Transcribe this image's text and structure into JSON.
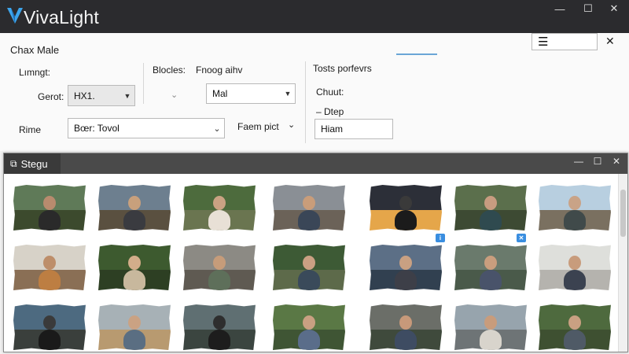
{
  "app": {
    "title": "VivaLight"
  },
  "window_controls": {
    "minimize": "—",
    "maximize": "☐",
    "close": "✕"
  },
  "panel": {
    "heading": "Chax Male",
    "menu_glyph": "☰",
    "close_glyph": "✕",
    "group1_label": "Lımngt:",
    "gerot_label": "Gerot:",
    "gerot_value": "HX1.",
    "rime_label": "Rime",
    "rime_value": "Bœr: Tovol",
    "blocles_label": "Blocles:",
    "fnoog_label": "Fnoog aihv",
    "mal_value": "Mal",
    "faem_label": "Faem pict",
    "tosts_label": "Tosts porfevrs",
    "chuut_label": "Chuut:",
    "dtep_label": "– Dtep",
    "hiam_value": "Hiam"
  },
  "gallery": {
    "tab_label": "Stegu",
    "controls": {
      "minimize": "—",
      "maximize": "☐",
      "close": "✕"
    },
    "photos": [
      {
        "sky": "#5f7a58",
        "ground": "#3c4a2d",
        "person": "#2a2a2a",
        "skin": "#b88b6e"
      },
      {
        "sky": "#6d7f8f",
        "ground": "#5a5040",
        "person": "#3a3b40",
        "skin": "#c8a07c"
      },
      {
        "sky": "#4d6b3d",
        "ground": "#6a7550",
        "person": "#e8e0d6",
        "skin": "#caa283"
      },
      {
        "sky": "#8a8f95",
        "ground": "#6b6258",
        "person": "#3a4657",
        "skin": "#c99d7a"
      },
      {
        "sky": "#2c2f38",
        "ground": "#e5a64a",
        "person": "#1b1b1b",
        "skin": "#3a3a3a"
      },
      {
        "sky": "#5b6f4c",
        "ground": "#3d4a33",
        "person": "#2f4a4f",
        "skin": "#c79c80"
      },
      {
        "sky": "#b8cfe0",
        "ground": "#7a7060",
        "person": "#404a4a",
        "skin": "#c9a387"
      },
      {
        "sky": "#d7d2c8",
        "ground": "#8a6f55",
        "person": "#bd7e42",
        "skin": "#bd8e6a"
      },
      {
        "sky": "#3d5a2f",
        "ground": "#2d3f23",
        "person": "#c8b89d",
        "skin": "#d3ad8a"
      },
      {
        "sky": "#8c8a84",
        "ground": "#5f5a52",
        "person": "#5e6f5a",
        "skin": "#c69c7a"
      },
      {
        "sky": "#3d5a35",
        "ground": "#5d6a4a",
        "person": "#3a4a5a",
        "skin": "#caa083"
      },
      {
        "sky": "#5c6f86",
        "ground": "#314050",
        "person": "#3d3f48",
        "skin": "#c9a082"
      },
      {
        "sky": "#6a7a6c",
        "ground": "#4a5a4a",
        "person": "#49536a",
        "skin": "#c99e7e"
      },
      {
        "sky": "#dedfdb",
        "ground": "#b5b3ae",
        "person": "#3b4250",
        "skin": "#c89c7c"
      },
      {
        "sky": "#4d6a80",
        "ground": "#3a3f3c",
        "person": "#1a1a1a",
        "skin": "#3a3a3a"
      },
      {
        "sky": "#a7b1b6",
        "ground": "#b89a70",
        "person": "#5a6e82",
        "skin": "#caa283"
      },
      {
        "sky": "#5f6f72",
        "ground": "#3b4540",
        "person": "#1d1d1d",
        "skin": "#2e2e2e"
      },
      {
        "sky": "#5a7845",
        "ground": "#3f5534",
        "person": "#5a6d8a",
        "skin": "#c9a082"
      },
      {
        "sky": "#6b6e68",
        "ground": "#3f4a3c",
        "person": "#3e4c62",
        "skin": "#c7997a"
      },
      {
        "sky": "#97a4ad",
        "ground": "#6e7476",
        "person": "#d8d4cc",
        "skin": "#c89c7c"
      },
      {
        "sky": "#4e6a3e",
        "ground": "#3e5031",
        "person": "#4f5a66",
        "skin": "#c9a082"
      }
    ],
    "badges": [
      {
        "glyph": "i",
        "color": "#3a8ee0"
      },
      {
        "glyph": "✕",
        "color": "#3a8ee0"
      }
    ]
  }
}
